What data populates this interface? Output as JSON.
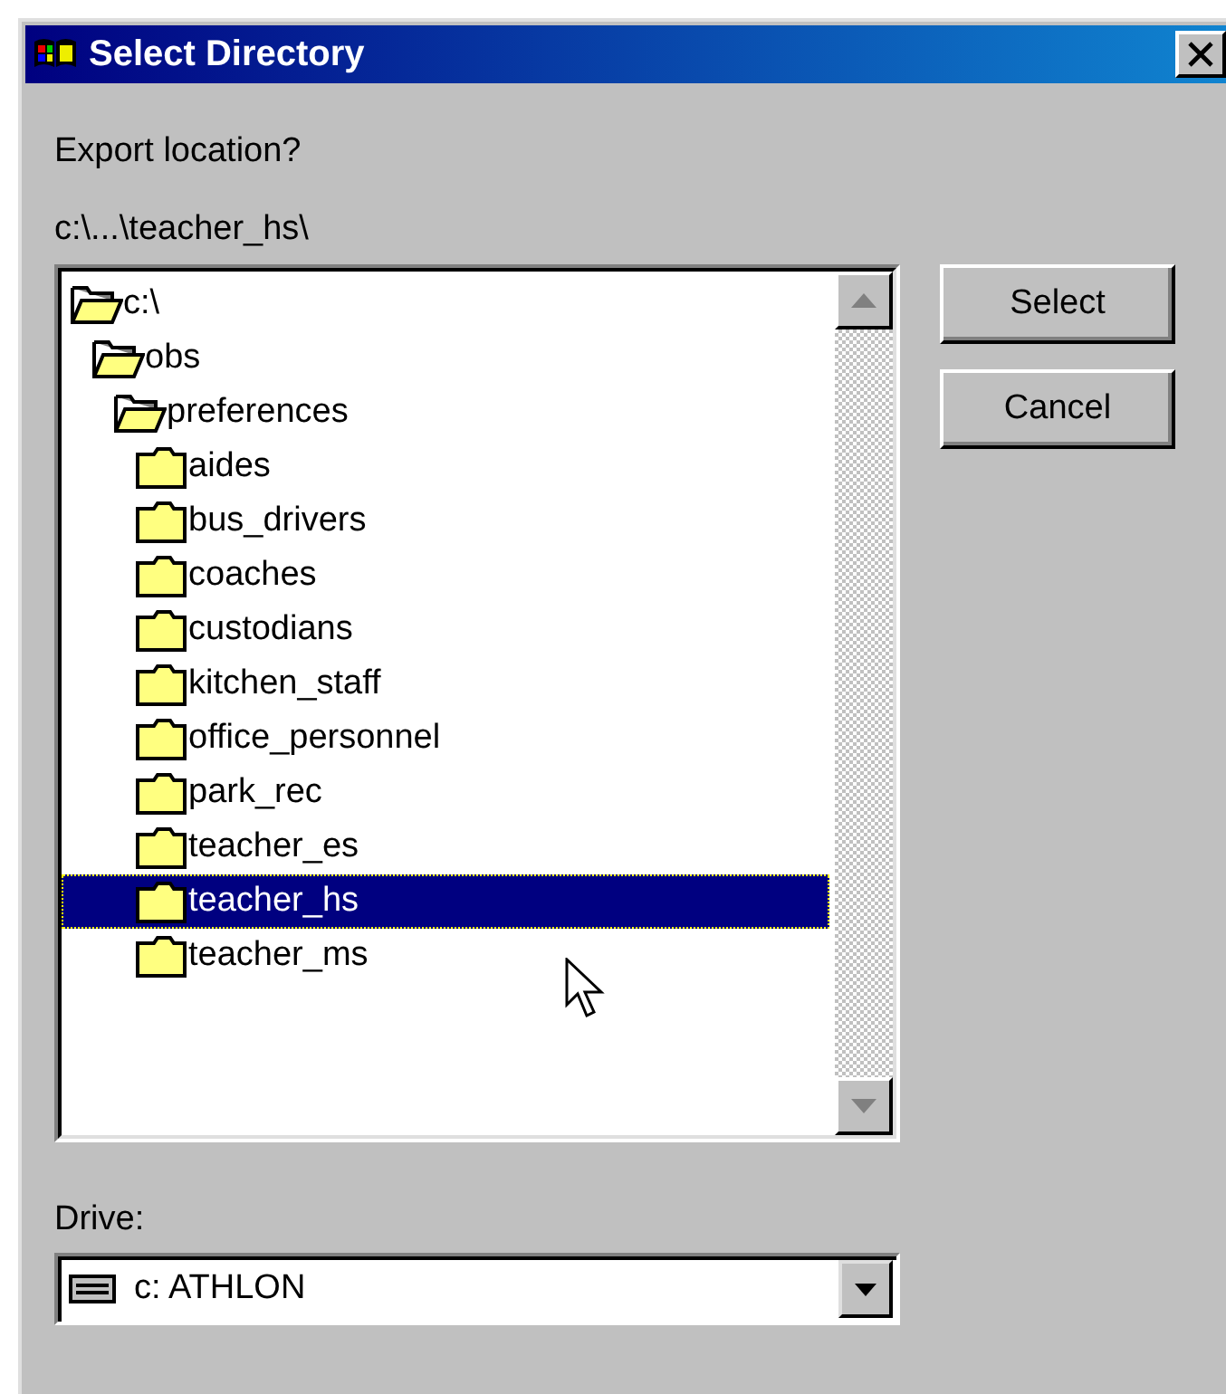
{
  "window": {
    "title": "Select Directory"
  },
  "prompt": "Export location?",
  "current_path": "c:\\...\\teacher_hs\\",
  "tree": [
    {
      "label": "c:\\",
      "expanded": true,
      "selected": false,
      "children": [
        {
          "label": "obs",
          "expanded": true,
          "selected": false,
          "children": [
            {
              "label": "preferences",
              "expanded": true,
              "selected": false,
              "children": [
                {
                  "label": "aides",
                  "expanded": false,
                  "selected": false
                },
                {
                  "label": "bus_drivers",
                  "expanded": false,
                  "selected": false
                },
                {
                  "label": "coaches",
                  "expanded": false,
                  "selected": false
                },
                {
                  "label": "custodians",
                  "expanded": false,
                  "selected": false
                },
                {
                  "label": "kitchen_staff",
                  "expanded": false,
                  "selected": false
                },
                {
                  "label": "office_personnel",
                  "expanded": false,
                  "selected": false
                },
                {
                  "label": "park_rec",
                  "expanded": false,
                  "selected": false
                },
                {
                  "label": "teacher_es",
                  "expanded": false,
                  "selected": false
                },
                {
                  "label": "teacher_hs",
                  "expanded": false,
                  "selected": true
                },
                {
                  "label": "teacher_ms",
                  "expanded": false,
                  "selected": false
                }
              ]
            }
          ]
        }
      ]
    }
  ],
  "buttons": [
    {
      "label": "Select"
    },
    {
      "label": "Cancel"
    }
  ],
  "drive": {
    "label": "Drive:",
    "value": "c: ATHLON"
  }
}
